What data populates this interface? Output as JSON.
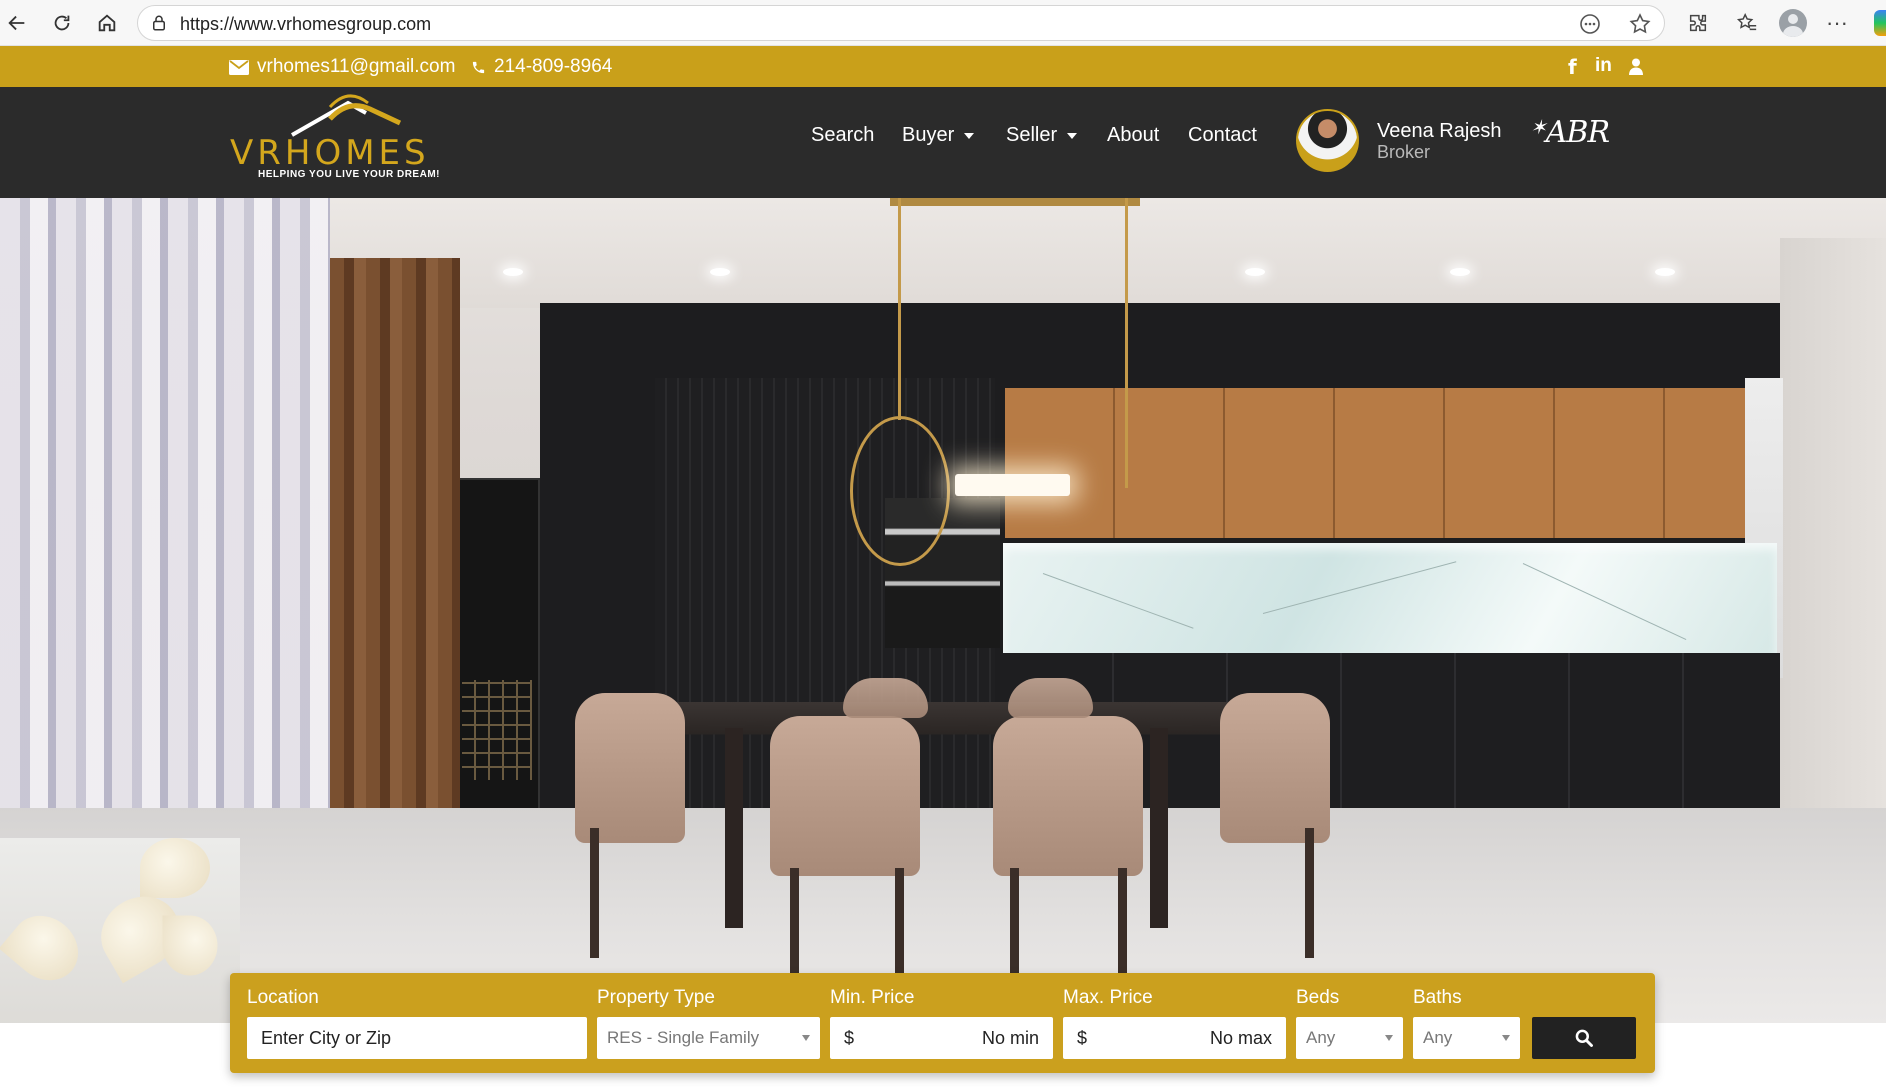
{
  "browser": {
    "url": "https://www.vrhomesgroup.com"
  },
  "topbar": {
    "email": "vrhomes11@gmail.com",
    "phone": "214-809-8964",
    "social_icons": [
      "facebook-icon",
      "linkedin-icon",
      "user-icon"
    ],
    "background_color": "#c9a01a"
  },
  "header": {
    "logo_word": "VRHOMES",
    "logo_tagline": "HELPING YOU LIVE YOUR DREAM!",
    "nav": [
      {
        "label": "Search",
        "dropdown": false
      },
      {
        "label": "Buyer",
        "dropdown": true
      },
      {
        "label": "Seller",
        "dropdown": true
      },
      {
        "label": "About",
        "dropdown": false
      },
      {
        "label": "Contact",
        "dropdown": false
      }
    ],
    "agent_name": "Veena Rajesh",
    "agent_role": "Broker",
    "badge": "ABR",
    "background_color": "#2b2b2b"
  },
  "search": {
    "location_label": "Location",
    "location_placeholder": "Enter City or Zip",
    "property_type_label": "Property Type",
    "property_type_value": "RES - Single Family",
    "min_price_label": "Min. Price",
    "min_price_currency": "$",
    "min_price_value": "No min",
    "max_price_label": "Max. Price",
    "max_price_currency": "$",
    "max_price_value": "No max",
    "beds_label": "Beds",
    "beds_value": "Any",
    "baths_label": "Baths",
    "baths_value": "Any",
    "panel_color": "#cba01e"
  }
}
